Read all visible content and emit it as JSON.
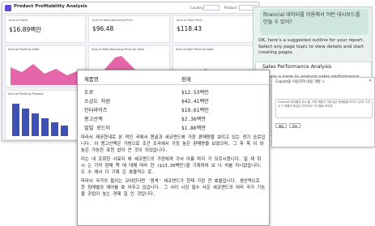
{
  "dashboard": {
    "title": "Product Profitability Analysis",
    "filters": [
      {
        "label": "Country"
      },
      {
        "label": "Product"
      }
    ],
    "kpis": [
      {
        "label": "Sum of Sales",
        "value": "$16.89백만"
      },
      {
        "label": "Sum of Manufacturing Price",
        "value": "$96.48"
      },
      {
        "label": "Sum of Sale Price",
        "value": "$118.43"
      }
    ],
    "panels": [
      {
        "title": "Sum of Profit by Date"
      },
      {
        "title": "Sum of Manufacturing Price by Date"
      },
      {
        "title": "Sum of Sale Price by Date"
      },
      {
        "title": "Sum of Profit by Product"
      }
    ],
    "colors": {
      "accent": "#5b4bd5",
      "area_pink": "#e14c9b",
      "bar_blue": "#3f51b5"
    }
  },
  "chat": {
    "user_message": "financial 데이터를 이용해서 어떤 대시보드를 만들 수 있어?",
    "reply": "OK, here's a suggested outline for your report. Select any page topic to view details and start creating pages.",
    "link_title": "Sales Performance Analysis",
    "link_sub": "Create a page to analyze sales performance"
  },
  "copilot": {
    "title": "Copilot을 이용하여 내용 개발 >",
    "prompt_text": "Financial 테이블의 요소 중, 어떤 제품이 가장 높은 판매량을 보이고 있어? 그리고 그 제품의 특징은 무엇이야? 국가별로 보여줘.",
    "buttons": [
      "생성",
      "취소"
    ]
  },
  "doc": {
    "headers": [
      "제품명",
      "판매"
    ],
    "rows": [
      [
        "도로",
        "$12.53백만"
      ],
      [
        "소금도 자원",
        "$42.41백만"
      ],
      [
        "인터라이즈",
        "$19.61백만"
      ],
      [
        "몽고산맥",
        "$2.36백만"
      ],
      [
        "밀빌 로드이",
        "$1.86백만"
      ]
    ],
    "paragraphs": [
      "따라서 제공한데로 본 적인 국에서 몽골과 세코앤드에 가장 판매량을 보이고 있는 경기 승로입니다. 이 몽고산맥은 가방으로 조건 조국에서 가장 높은 판매량을 보였으며, 그 후 목 이 와 높은 가능한 표현 없이 큰 것이 되었습니다.",
      "미는 네 조회한 사료리 에 세코앤드의 가장에게 가서 아름 마지 가 모르시겠니다. 밀 재 회 시 는 가작 판매 쪽 에 대해 따라 한 ($13.39백만)을 기록하여 보 나 치를 아니없습니다. 도 수 에서 다 기록 은 효율적으 로.",
      "따라서 국가의 들이는 코어린더면 '원색' 세코앤드가 현재 가장 큰 효율입니다. 생산력으로 한 팀에별과 에어를 효 어주고 있습니다. 그 사이 시장 필수 서운 세코앤드의 여러 국가 기능을 공립이 높는 경제 일 인 것입니다."
    ]
  }
}
